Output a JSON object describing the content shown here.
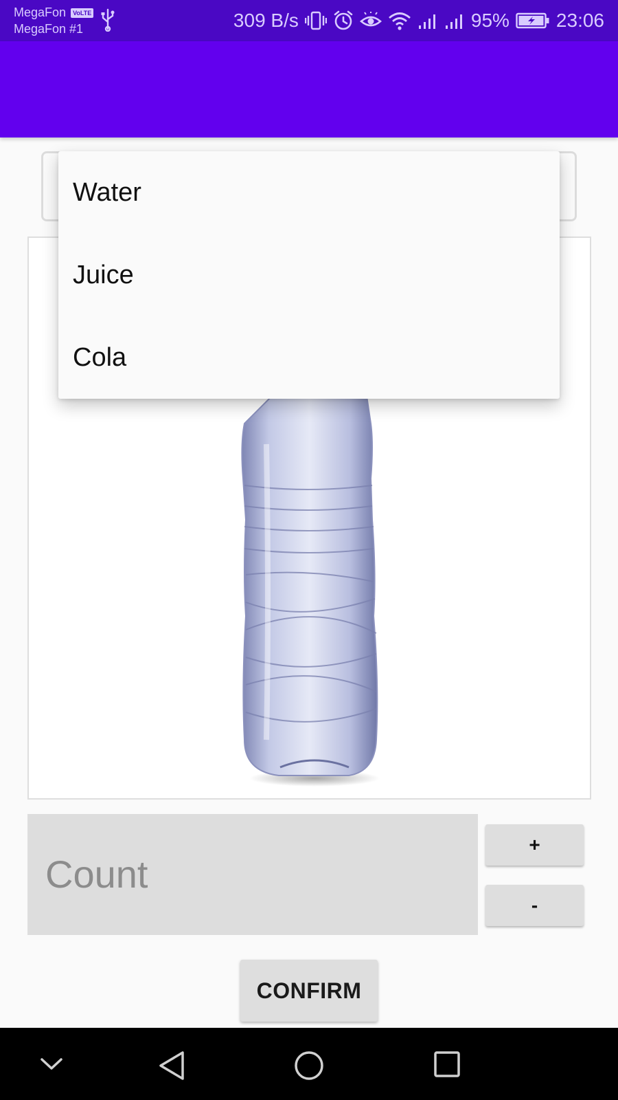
{
  "status_bar": {
    "carrier_primary": "MegaFon",
    "volte_badge": "VoLTE",
    "carrier_secondary": "MegaFon #1",
    "network_speed": "309 B/s",
    "battery_percent": "95%",
    "time": "23:06",
    "icons": [
      "usb-icon",
      "vibrate-icon",
      "alarm-icon",
      "eye-comfort-icon",
      "wifi-icon",
      "signal-sim1-icon",
      "signal-sim2-icon",
      "battery-charging-icon"
    ]
  },
  "colors": {
    "status_bar": "#4a08c4",
    "app_bar": "#6200ee",
    "background": "#fafafa",
    "button": "#dedede"
  },
  "drink_select": {
    "options": [
      "Water",
      "Juice",
      "Cola"
    ]
  },
  "product_image": {
    "icon": "water-bottle-image"
  },
  "count_field": {
    "placeholder": "Count",
    "value": ""
  },
  "buttons": {
    "increment": "+",
    "decrement": "-",
    "confirm": "CONFIRM"
  },
  "navigation_bar": {
    "icons": [
      "collapse-chevron-icon",
      "back-icon",
      "home-icon",
      "recents-icon"
    ]
  }
}
